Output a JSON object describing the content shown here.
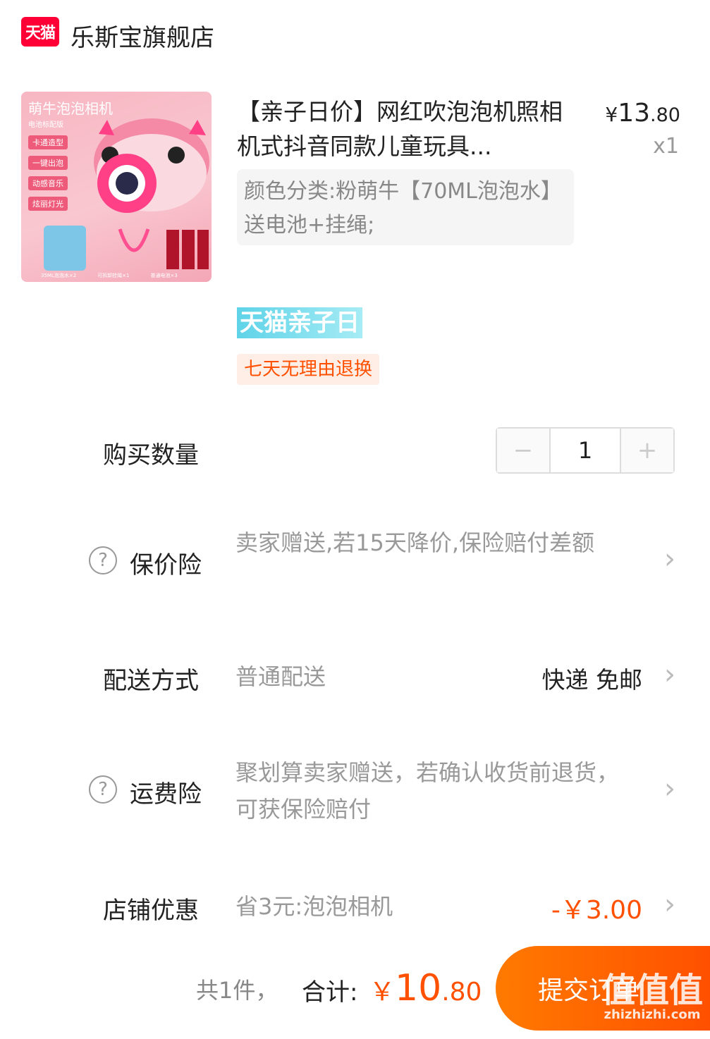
{
  "store": {
    "logo_text": "天猫",
    "name": "乐斯宝旗舰店"
  },
  "product": {
    "image_text": {
      "title": "萌牛泡泡相机",
      "subtitle": "电池标配版",
      "features": [
        "卡通造型",
        "一键出泡",
        "动感音乐",
        "炫丽灯光"
      ],
      "accessories": [
        "35ML泡泡水×2",
        "可拆卸挂绳×1",
        "普通电池×3"
      ]
    },
    "title": "【亲子日价】网红吹泡泡机照相机式抖音同款儿童玩具...",
    "price_symbol": "¥",
    "price_int": "13",
    "price_cents": ".80",
    "quantity_label": "x1",
    "sku": "颜色分类:粉萌牛【70ML泡泡水】送电池+挂绳;",
    "promo_tag": "天猫亲子日",
    "return_tag": "七天无理由退换"
  },
  "quantity": {
    "label": "购买数量",
    "minus": "−",
    "value": "1",
    "plus": "+"
  },
  "price_protection": {
    "label": "保价险",
    "description": "卖家赠送,若15天降价,保险赔付差额"
  },
  "shipping": {
    "label": "配送方式",
    "method": "普通配送",
    "value": "快递 免邮"
  },
  "freight_insurance": {
    "label": "运费险",
    "description": "聚划算卖家赠送，若确认收货前退货，可获保险赔付"
  },
  "store_discount": {
    "label": "店铺优惠",
    "description": "省3元:泡泡相机",
    "value": "-￥3.00"
  },
  "footer": {
    "count": "共1件，",
    "total_label": "合计:",
    "total_symbol": "￥",
    "total_int": "10",
    "total_cents": ".80",
    "submit": "提交订单",
    "watermark": "值值值",
    "watermark_url": "zhizhizhi.com"
  },
  "colors": {
    "accent": "#ff5000",
    "tmall_red": "#ff0036",
    "promo_cyan": "#5fd3e8"
  },
  "icons": {
    "help": "help-circle-icon",
    "chevron": "chevron-right-icon"
  }
}
